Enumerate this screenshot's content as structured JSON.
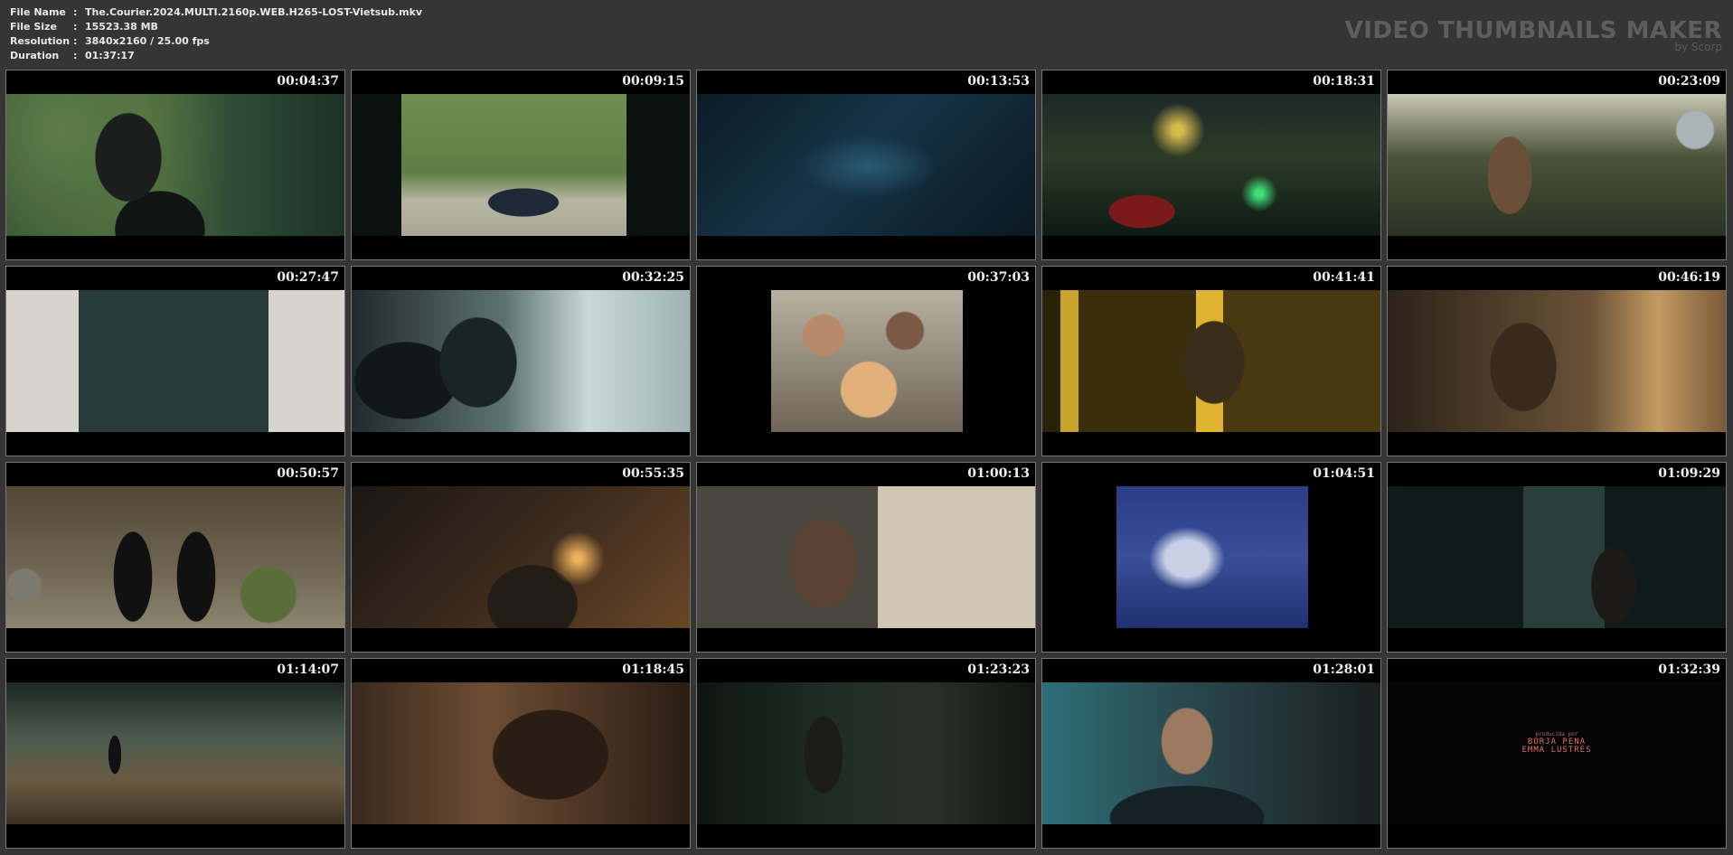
{
  "info": [
    {
      "key": "File Name",
      "sep": ":",
      "value": "The.Courier.2024.MULTI.2160p.WEB.H265-LOST-Vietsub.mkv"
    },
    {
      "key": "File Size",
      "sep": ":",
      "value": "15523.38 MB"
    },
    {
      "key": "Resolution",
      "sep": ":",
      "value": "3840x2160 / 25.00 fps"
    },
    {
      "key": "Duration",
      "sep": ":",
      "value": "01:37:17"
    }
  ],
  "brand": {
    "title": "VIDEO THUMBNAILS MAKER",
    "subtitle": "by Scorp"
  },
  "thumbnails": [
    {
      "time": "00:04:37"
    },
    {
      "time": "00:09:15"
    },
    {
      "time": "00:13:53"
    },
    {
      "time": "00:18:31"
    },
    {
      "time": "00:23:09"
    },
    {
      "time": "00:27:47"
    },
    {
      "time": "00:32:25"
    },
    {
      "time": "00:37:03"
    },
    {
      "time": "00:41:41"
    },
    {
      "time": "00:46:19"
    },
    {
      "time": "00:50:57"
    },
    {
      "time": "00:55:35"
    },
    {
      "time": "01:00:13"
    },
    {
      "time": "01:04:51"
    },
    {
      "time": "01:09:29"
    },
    {
      "time": "01:14:07"
    },
    {
      "time": "01:18:45"
    },
    {
      "time": "01:23:23"
    },
    {
      "time": "01:28:01"
    },
    {
      "time": "01:32:39"
    }
  ],
  "credits": {
    "line1": "producida por",
    "line2": "BORJA PENA",
    "line3": "EMMA LUSTRES"
  }
}
